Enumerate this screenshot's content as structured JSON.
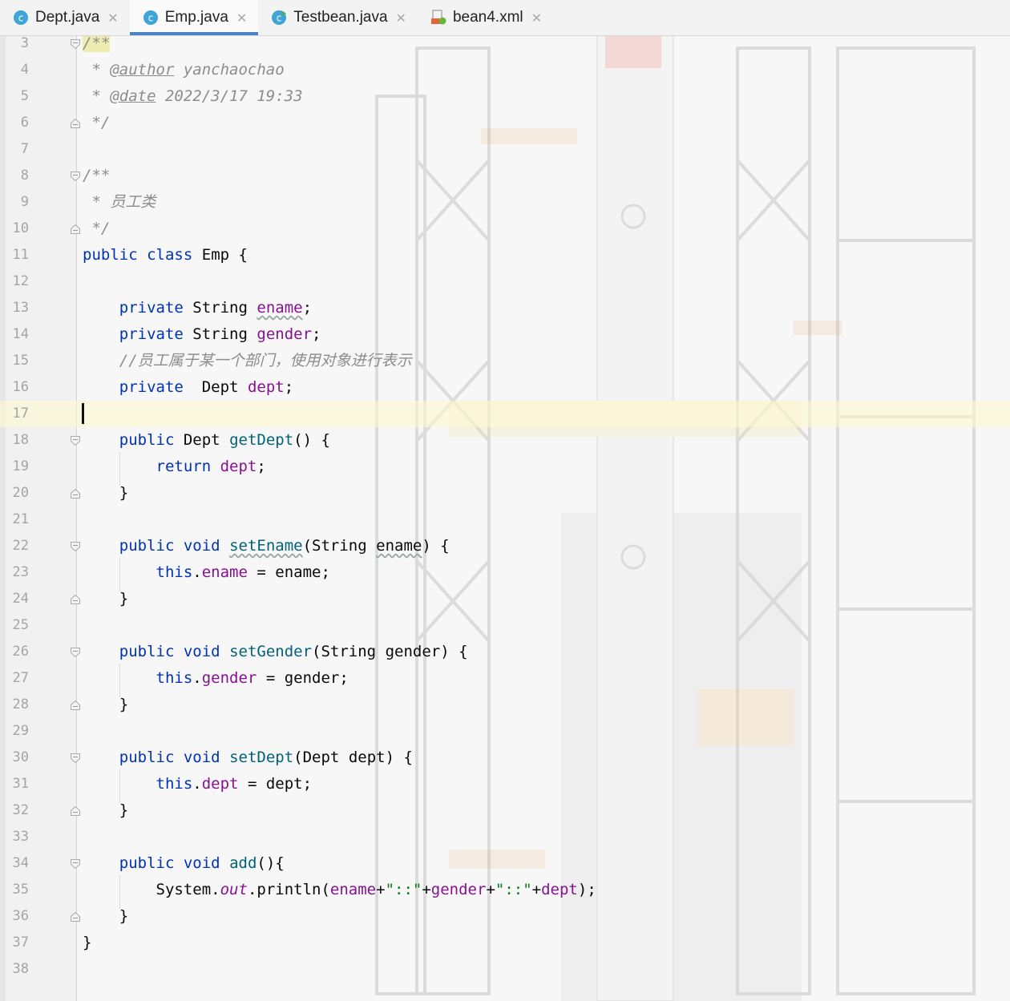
{
  "tabs": [
    {
      "label": "Dept.java",
      "type": "java-class",
      "active": false
    },
    {
      "label": "Emp.java",
      "type": "java-class",
      "active": true
    },
    {
      "label": "Testbean.java",
      "type": "java-class-runnable",
      "active": false
    },
    {
      "label": "bean4.xml",
      "type": "xml",
      "active": false
    }
  ],
  "close_glyph": "✕",
  "editor": {
    "current_line": 17,
    "line_numbers": [
      "3",
      "4",
      "5",
      "6",
      "7",
      "8",
      "9",
      "10",
      "11",
      "12",
      "13",
      "14",
      "15",
      "16",
      "17",
      "18",
      "19",
      "20",
      "21",
      "22",
      "23",
      "24",
      "25",
      "26",
      "27",
      "28",
      "29",
      "30",
      "31",
      "32",
      "33",
      "34",
      "35",
      "36",
      "37",
      "38"
    ],
    "code": {
      "c_open1": "/**",
      "c_star_author": " * ",
      "c_author_tag": "@author",
      "c_author_val": " yanchaochao",
      "c_star_date": " * ",
      "c_date_tag": "@date",
      "c_date_val": " 2022/3/17 19:33",
      "c_close1": " */",
      "c_open2": "/**",
      "c_desc": " * 员工类",
      "c_close2": " */",
      "kw_public": "public",
      "kw_class": "class",
      "kw_private": "private",
      "kw_void": "void",
      "kw_return": "return",
      "kw_this": "this",
      "class_name": "Emp",
      "type_string": "String",
      "type_dept": "Dept",
      "f_ename": "ename",
      "f_gender": "gender",
      "f_dept": "dept",
      "line_comment": "//员工属于某一个部门，使用对象进行表示",
      "m_getDept": "getDept",
      "m_setEname": "setEname",
      "m_setGender": "setGender",
      "m_setDept": "setDept",
      "m_add": "add",
      "p_ename": "ename",
      "p_gender": "gender",
      "p_dept": "dept",
      "sys": "System",
      "out": "out",
      "println": "println",
      "sep": "\"::\""
    }
  },
  "colors": {
    "keyword": "#0033b3",
    "field": "#871094",
    "method": "#00627a",
    "string": "#067d17",
    "comment": "#8c8c8c",
    "tab_active_underline": "#4a82c6"
  }
}
